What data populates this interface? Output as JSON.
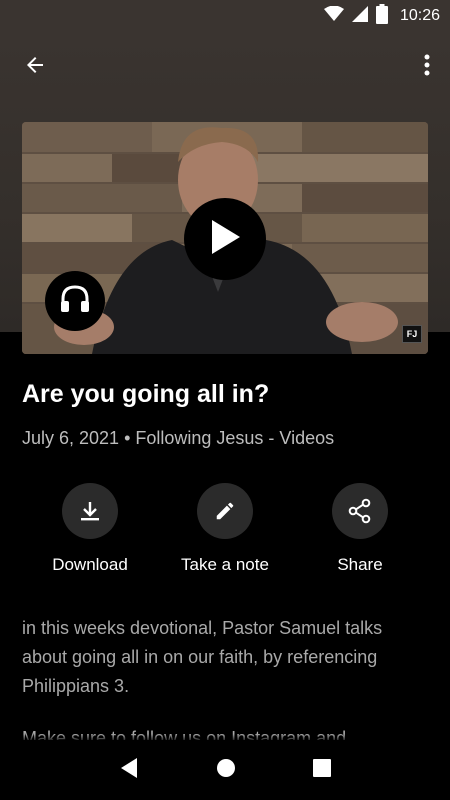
{
  "status_bar": {
    "time": "10:26",
    "icons": [
      "wifi-icon",
      "signal-icon",
      "battery-icon"
    ]
  },
  "header": {
    "back_icon": "arrow-left-icon",
    "menu_icon": "more-vert-icon"
  },
  "video": {
    "play_icon": "play-icon",
    "audio_icon": "headphones-icon",
    "badge": "FJ"
  },
  "title": "Are you going all in?",
  "meta": "July 6, 2021 • Following Jesus - Videos",
  "actions": [
    {
      "label": "Download",
      "icon": "download-icon"
    },
    {
      "label": "Take a note",
      "icon": "pencil-icon"
    },
    {
      "label": "Share",
      "icon": "share-icon"
    }
  ],
  "description": "in this weeks devotional, Pastor Samuel talks about going all in on our faith, by referencing Philippians 3.",
  "description_more": "Make sure to follow us on Instagram and",
  "nav": {
    "back": "nav-back-icon",
    "home": "nav-home-icon",
    "recents": "nav-recents-icon"
  },
  "colors": {
    "header_bg": "#3a3430",
    "background": "#000000",
    "meta_text": "#bdbdbd",
    "description_text": "#a9a9a9",
    "action_circle": "#2b2b2b"
  }
}
